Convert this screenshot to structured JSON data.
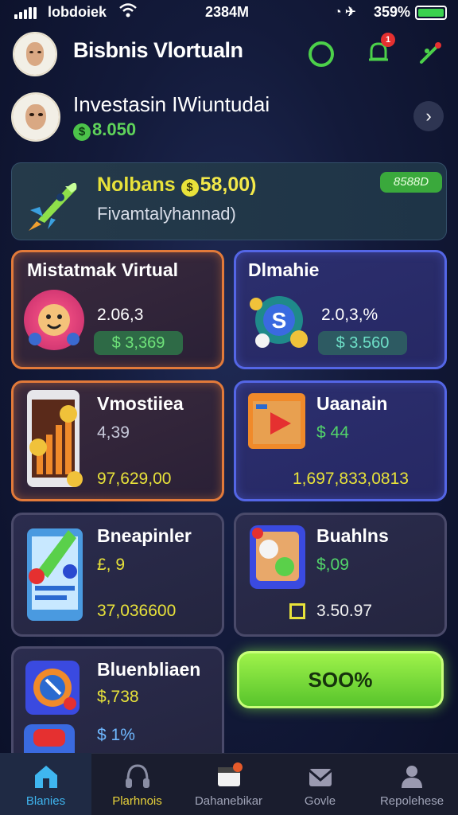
{
  "status_bar": {
    "carrier": "lobdoiek",
    "time": "2384M",
    "battery_pct": "359%",
    "battery_color": "#3ad24e"
  },
  "header": {
    "title": "Bisbnis Vlortualn",
    "notification_count": "1",
    "icons": [
      "refresh-ring-icon",
      "bell-icon",
      "pin-icon"
    ]
  },
  "profile": {
    "name": "Investasin IWiuntudai",
    "balance": "8.050"
  },
  "bonus_banner": {
    "title": "Nolbans",
    "amount": "58,00)",
    "subtitle": "Fivamtalyhannad)",
    "pill": "8588D"
  },
  "cards": [
    {
      "title": "Mistatmak Virtual",
      "value": "2.06,3",
      "pill": "$ 3,369"
    },
    {
      "title": "Dlmahie",
      "value": "2.0,3,%",
      "pill": "$ 3.560"
    },
    {
      "title": "Vmostiiea",
      "value": "4,39",
      "sub": "97,629,00"
    },
    {
      "title": "Uaanain",
      "value": "$ 44",
      "sub": "1,697,833,0813"
    },
    {
      "title": "Bneapinler",
      "value": "£, 9",
      "sub": "37,036600"
    },
    {
      "title": "Buahlns",
      "value": "$,09",
      "sub": "3.50.97"
    },
    {
      "title": "Bluenbliaen",
      "value": "$,738",
      "sub": "$ 1%"
    }
  ],
  "action_button": {
    "label": "SOO%"
  },
  "bottom_nav": [
    {
      "label": "Blanies",
      "icon": "home-icon",
      "active": true
    },
    {
      "label": "Plarhnois",
      "icon": "headset-icon",
      "active": false
    },
    {
      "label": "Dahanebikar",
      "icon": "card-icon",
      "active": false
    },
    {
      "label": "Govle",
      "icon": "mail-icon",
      "active": false
    },
    {
      "label": "Repolehese",
      "icon": "user-icon",
      "active": false
    }
  ],
  "colors": {
    "accent_green": "#5fd35a",
    "accent_yellow": "#e8e23a",
    "card_orange_border": "#e27a3a",
    "card_blue_border": "#5466e6",
    "nav_active": "#3fb6f0"
  }
}
